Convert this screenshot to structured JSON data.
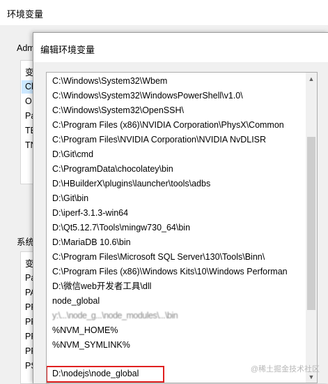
{
  "background_window": {
    "title": "环境变量",
    "user_group_label": "Adm",
    "user_list_header": "变",
    "user_list_items": [
      "Ch",
      "O",
      "Pa",
      "TE",
      "TN"
    ],
    "system_group_label": "系统",
    "system_list_header": "变",
    "system_list_items": [
      "Pa",
      "PA",
      "PF",
      "PF",
      "PF",
      "PF",
      "PS"
    ]
  },
  "dialog": {
    "title": "编辑环境变量",
    "paths": [
      "C:\\Windows\\System32\\Wbem",
      "C:\\Windows\\System32\\WindowsPowerShell\\v1.0\\",
      "C:\\Windows\\System32\\OpenSSH\\",
      "C:\\Program Files (x86)\\NVIDIA Corporation\\PhysX\\Common",
      "C:\\Program Files\\NVIDIA Corporation\\NVIDIA NvDLISR",
      "D:\\Git\\cmd",
      "C:\\ProgramData\\chocolatey\\bin",
      "D:\\HBuilderX\\plugins\\launcher\\tools\\adbs",
      "D:\\Git\\bin",
      "D:\\iperf-3.1.3-win64",
      "D:\\Qt5.12.7\\Tools\\mingw730_64\\bin",
      "D:\\MariaDB 10.6\\bin",
      "C:\\Program Files\\Microsoft SQL Server\\130\\Tools\\Binn\\",
      "C:\\Program Files (x86)\\Windows Kits\\10\\Windows Performan",
      "D:\\微信web开发者工具\\dll",
      "node_global",
      "y:\\...\\node_g...\\node_modules\\...\\bin",
      "%NVM_HOME%",
      "%NVM_SYMLINK%",
      "",
      "D:\\nodejs\\node_global"
    ],
    "highlighted_path_index": 20
  },
  "watermark": "@稀土掘金技术社区",
  "colors": {
    "highlight_border": "#e02020",
    "selection": "#cce8ff",
    "scroll_thumb": "#cdcdcd"
  }
}
